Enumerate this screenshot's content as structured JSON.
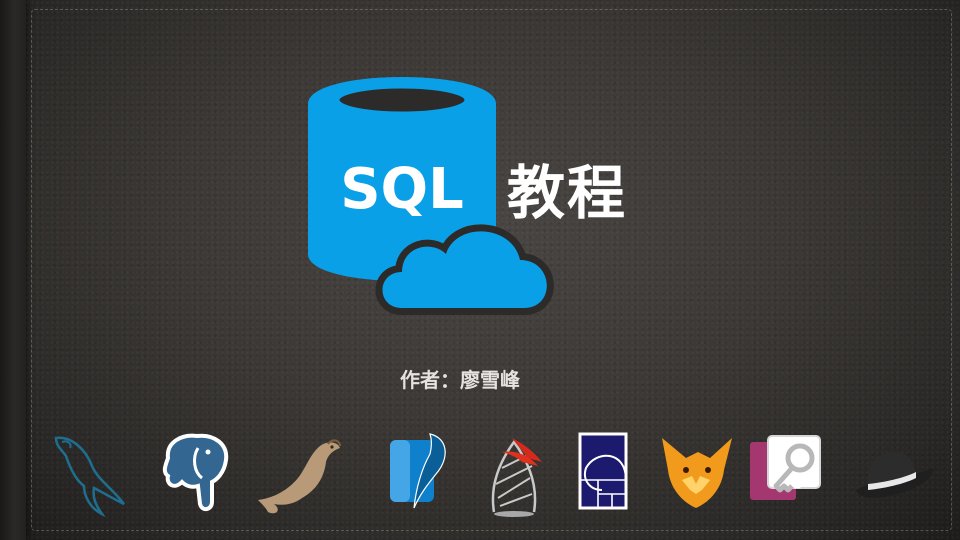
{
  "slide": {
    "title": "教程",
    "logo_text": "SQL",
    "author_line": "作者：廖雪峰"
  },
  "icons": {
    "main_logo": "sql-database-cloud-icon",
    "databases": [
      "mysql-dolphin-icon",
      "postgresql-elephant-icon",
      "mariadb-seal-icon",
      "sqlite-feather-icon",
      "sql-server-icon",
      "golden-ratio-db-icon",
      "foxpro-fox-icon",
      "ms-access-key-icon",
      "fedora-hat-icon"
    ]
  },
  "colors": {
    "brand_blue": "#0aa0e8",
    "text_white": "#ffffff",
    "author_text": "#e6e3df"
  }
}
